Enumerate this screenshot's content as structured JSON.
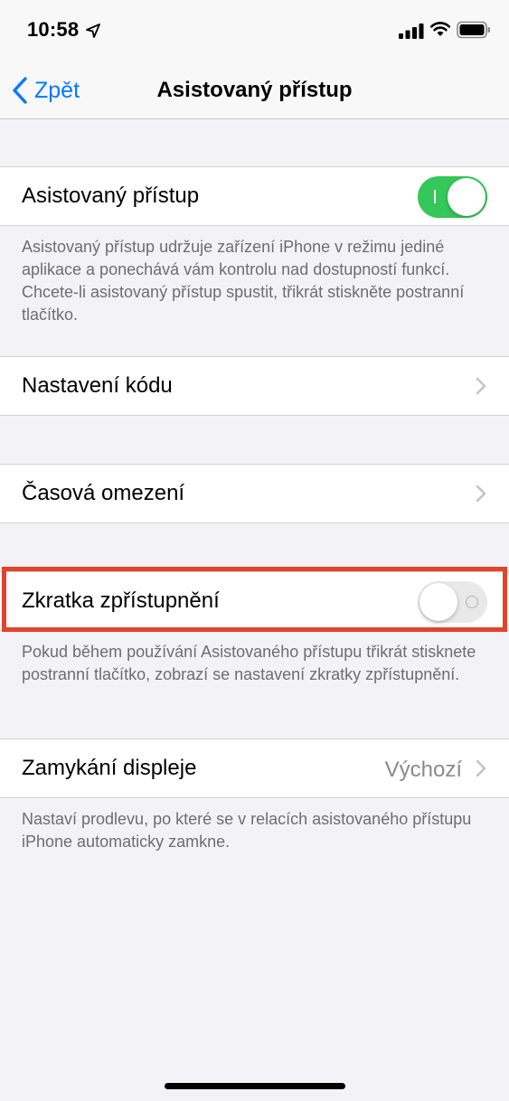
{
  "status_bar": {
    "time": "10:58",
    "icons": [
      "location-arrow-icon",
      "cellular-signal-icon",
      "wifi-icon",
      "battery-icon"
    ]
  },
  "nav": {
    "back_label": "Zpět",
    "title": "Asistovaný přístup"
  },
  "sections": {
    "guided_access": {
      "label": "Asistovaný přístup",
      "enabled": true,
      "footer": "Asistovaný přístup udržuje zařízení iPhone v režimu jediné aplikace a ponechává vám kontrolu nad dostupností funkcí. Chcete-li asistovaný přístup spustit, třikrát stiskněte postranní tlačítko."
    },
    "passcode": {
      "label": "Nastavení kódu"
    },
    "time_limits": {
      "label": "Časová omezení"
    },
    "accessibility_shortcut": {
      "label": "Zkratka zpřístupnění",
      "enabled": false,
      "highlighted": true,
      "footer": "Pokud během používání Asistovaného přístupu třikrát stisknete postranní tlačítko, zobrazí se nastavení zkratky zpřístupnění."
    },
    "display_lock": {
      "label": "Zamykání displeje",
      "value": "Výchozí",
      "footer": "Nastaví prodlevu, po které se v relacích asistovaného přístupu iPhone automaticky zamkne."
    }
  },
  "colors": {
    "accent": "#007aff",
    "switch_on": "#34c759",
    "highlight": "#e2432a",
    "background": "#f2f2f7"
  }
}
